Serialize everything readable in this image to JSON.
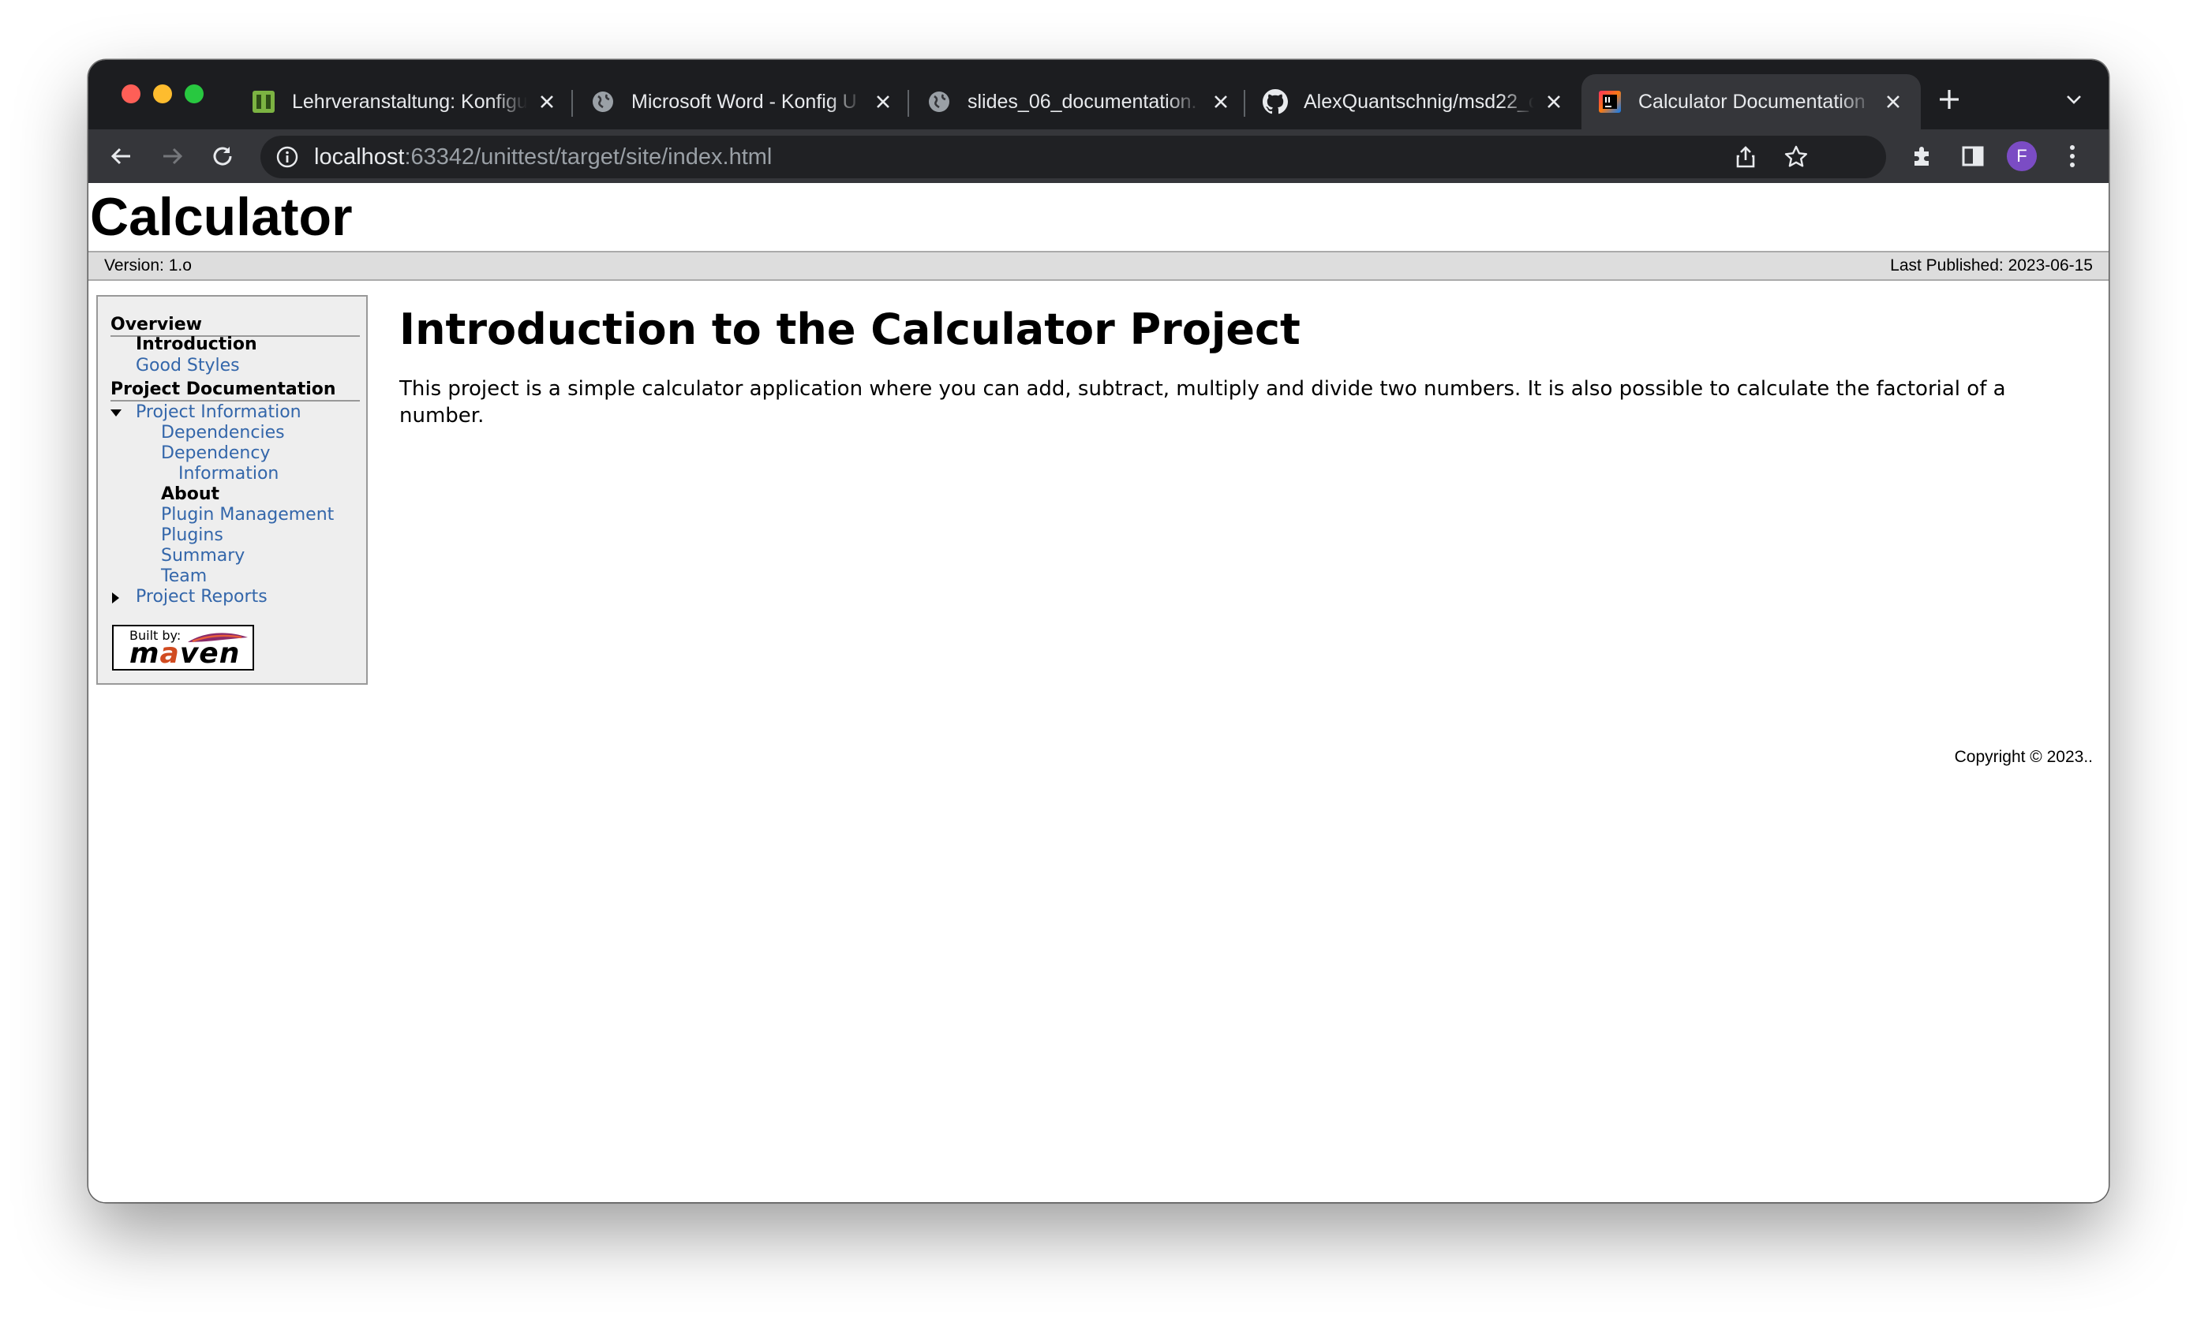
{
  "browser": {
    "tabs": [
      {
        "title": "Lehrveranstaltung: Konfigu",
        "favicon": "moodle-icon"
      },
      {
        "title": "Microsoft Word - Konfig U",
        "favicon": "globe-icon"
      },
      {
        "title": "slides_06_documentation.",
        "favicon": "globe-icon"
      },
      {
        "title": "AlexQuantschnig/msd22_c",
        "favicon": "github-icon"
      },
      {
        "title": "Calculator Documentation",
        "favicon": "intellij-icon",
        "active": true
      }
    ],
    "url": {
      "host": "localhost",
      "rest": ":63342/unittest/target/site/index.html"
    },
    "profile_initial": "F",
    "colors": {
      "chrome_dark": "#1c1d20",
      "toolbar": "#35363a",
      "profile": "#7b4cc4"
    }
  },
  "site": {
    "banner_title": "Calculator",
    "version": "Version: 1.o",
    "last_published": "Last Published: 2023-06-15",
    "nav": {
      "overview_heading": "Overview",
      "introduction": "Introduction",
      "good_styles": "Good Styles",
      "project_documentation_heading": "Project Documentation",
      "project_information": "Project Information",
      "dependencies": "Dependencies",
      "dependency": "Dependency",
      "information": "Information",
      "about": "About",
      "plugin_management": "Plugin Management",
      "plugins": "Plugins",
      "summary": "Summary",
      "team": "Team",
      "project_reports": "Project Reports"
    },
    "built_by": {
      "label": "Built by:",
      "m": "m",
      "a": "a",
      "ven": "ven"
    },
    "heading": "Introduction to the Calculator Project",
    "paragraph": "This project is a simple calculator application where you can add, subtract, multiply and divide two numbers. It is also possible to calculate the factorial of a number.",
    "copyright": "Copyright © 2023.."
  }
}
